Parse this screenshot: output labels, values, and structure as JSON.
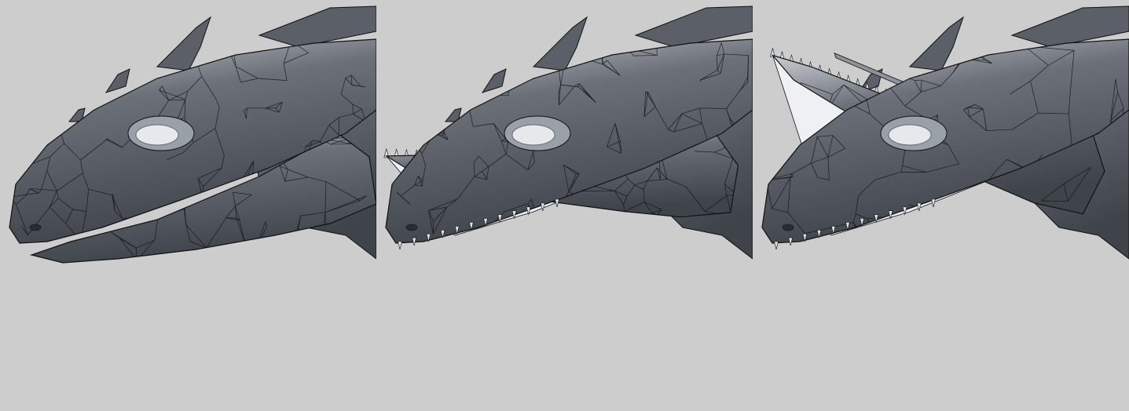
{
  "scene": {
    "background_color": "#cdcdcd",
    "mesh_fill_dark": "#3f434a",
    "mesh_fill_light": "#c9ccd3",
    "wire_color": "#111111",
    "interior_color": "#eef0f3"
  },
  "panels": [
    {
      "label": "",
      "mouth_open": 0.0
    },
    {
      "label": "",
      "mouth_open": 0.5
    },
    {
      "label": "",
      "mouth_open": 1.0
    }
  ]
}
